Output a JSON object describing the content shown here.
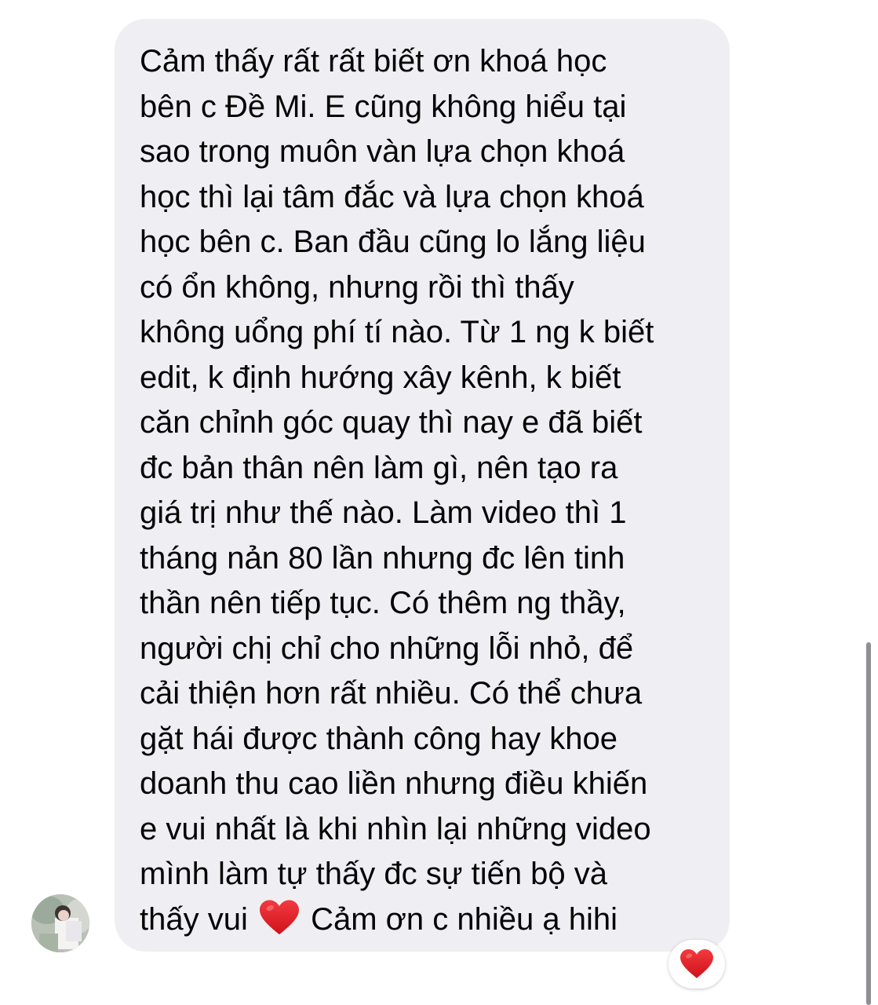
{
  "message": {
    "lines": [
      "Cảm thấy rất rất biết ơn khoá học",
      "bên c Đề Mi. E cũng không hiểu tại",
      "sao trong muôn vàn lựa chọn khoá",
      "học thì lại tâm đắc và lựa chọn khoá",
      "học bên c. Ban đầu cũng lo lắng liệu",
      "có ổn không, nhưng rồi thì thấy",
      "không uổng phí tí nào. Từ 1 ng k biết",
      "edit, k định hướng xây kênh, k biết",
      "căn chỉnh góc quay thì nay e đã biết",
      "đc bản thân nên làm gì, nên tạo ra",
      "giá trị như thế nào. Làm video thì 1",
      "tháng nản 80 lần nhưng đc lên tinh",
      "thần nên tiếp tục. Có thêm ng thầy,",
      "người chị chỉ cho những lỗi nhỏ, để",
      "cải thiện hơn rất nhiều. Có thể chưa",
      "gặt hái được thành công hay khoe",
      "doanh thu cao liền nhưng điều khiến",
      "e vui nhất là khi nhìn lại những video",
      "mình làm tự thấy đc sự tiến bộ và"
    ],
    "last_line_before": "thấy vui",
    "last_line_after": "Cảm ơn c nhiều ạ hihi",
    "inline_icon": "red-heart-emoji"
  },
  "reaction": {
    "icon": "red-heart-emoji",
    "color": "#e0191f"
  },
  "colors": {
    "bubble": "#efeff3",
    "text": "#050505",
    "heart": "#e0191f"
  }
}
